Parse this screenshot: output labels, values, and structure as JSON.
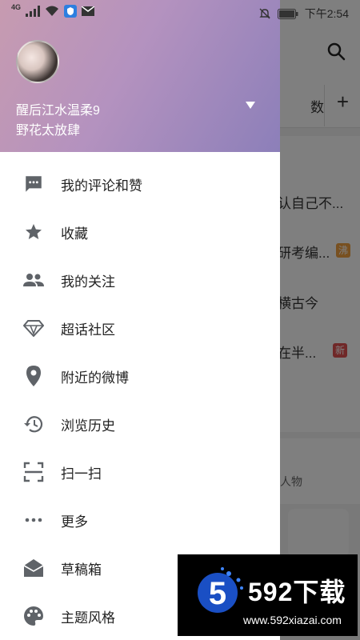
{
  "status_bar": {
    "network": "4G",
    "time": "下午2:54"
  },
  "background": {
    "tab_partial": "数",
    "plus": "+",
    "rows": [
      "认自己不...",
      "研考编...",
      "横古今",
      "在半..."
    ],
    "tags": [
      {
        "text": "沸",
        "color": "#f0a040"
      },
      {
        "text": "新",
        "color": "#e05050"
      }
    ],
    "card2_text": "人物"
  },
  "drawer": {
    "username": "醒后江水温柔9",
    "subtitle": "野花太放肆",
    "menu": [
      {
        "label": "我的评论和赞",
        "icon": "comment-icon"
      },
      {
        "label": "收藏",
        "icon": "star-icon"
      },
      {
        "label": "我的关注",
        "icon": "people-icon"
      },
      {
        "label": "超话社区",
        "icon": "diamond-icon"
      },
      {
        "label": "附近的微博",
        "icon": "location-icon"
      },
      {
        "label": "浏览历史",
        "icon": "history-icon"
      },
      {
        "label": "扫一扫",
        "icon": "scan-icon"
      },
      {
        "label": "更多",
        "icon": "more-icon"
      },
      {
        "label": "草稿箱",
        "icon": "drafts-icon"
      },
      {
        "label": "主题风格",
        "icon": "palette-icon"
      }
    ]
  },
  "watermark": {
    "brand": "592下载",
    "url": "www.592xiazai.com",
    "logo_digit": "5"
  },
  "colors": {
    "header_start": "#c79bb0",
    "header_end": "#8c7fb9",
    "icon": "#5f6368"
  }
}
